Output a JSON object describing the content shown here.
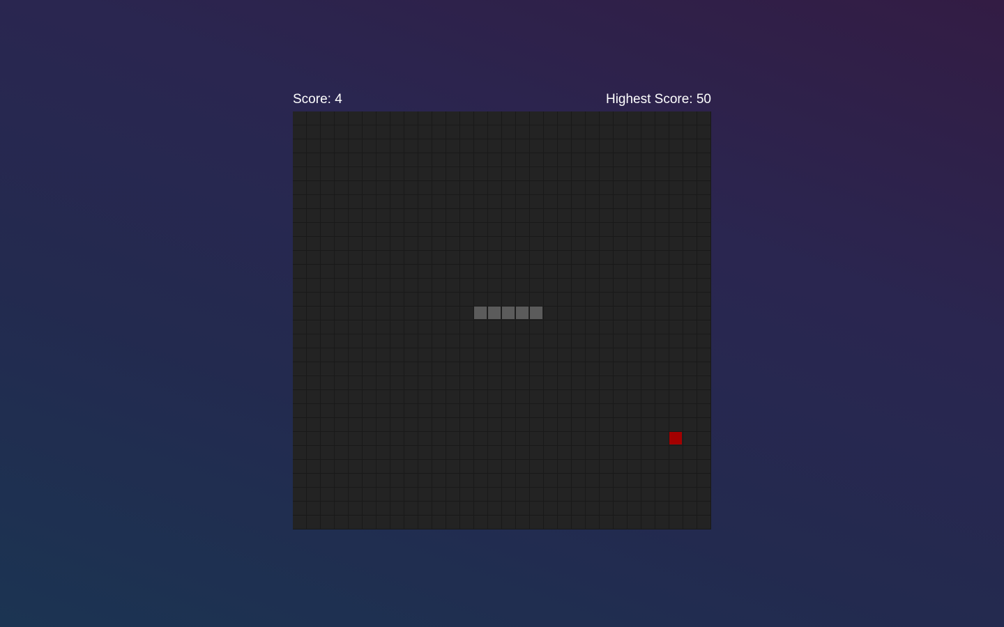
{
  "scoreboard": {
    "score_label": "Score: 4",
    "highest_label": "Highest Score: 50"
  },
  "game": {
    "grid_cols": 30,
    "grid_rows": 30,
    "snake": [
      {
        "col": 13,
        "row": 14
      },
      {
        "col": 14,
        "row": 14
      },
      {
        "col": 15,
        "row": 14
      },
      {
        "col": 16,
        "row": 14
      },
      {
        "col": 17,
        "row": 14
      }
    ],
    "food": {
      "col": 27,
      "row": 23
    },
    "colors": {
      "board": "#232323",
      "grid_line": "#191919",
      "snake": "#5b5b5b",
      "food": "#a30000"
    }
  }
}
